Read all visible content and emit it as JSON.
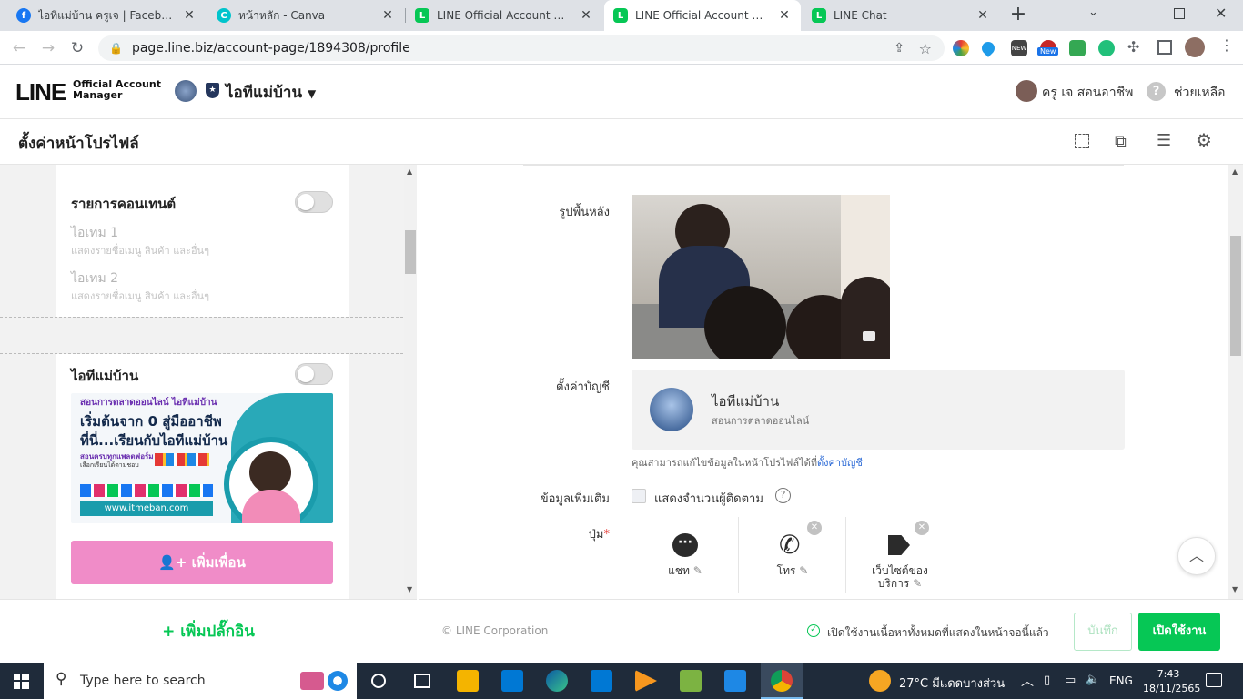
{
  "browser": {
    "tabs": [
      {
        "title": "ไอทีแม่บ้าน ครูเจ | Facebook",
        "icon": "facebook-icon",
        "color": "#1877f2"
      },
      {
        "title": "หน้าหลัก - Canva",
        "icon": "canva-icon",
        "color": "#00c4cc"
      },
      {
        "title": "LINE Official Account Manag",
        "icon": "line-icon",
        "color": "#06c755"
      },
      {
        "title": "LINE Official Account Manag",
        "icon": "line-icon",
        "color": "#06c755"
      },
      {
        "title": "LINE Chat",
        "icon": "line-icon",
        "color": "#06c755"
      }
    ],
    "new_tab": "+",
    "url": "page.line.biz/account-page/1894308/profile",
    "ext_new_badge": "New"
  },
  "header": {
    "logo_main": "LINE",
    "logo_sub1": "Official Account",
    "logo_sub2": "Manager",
    "account_name": "ไอทีแม่บ้าน",
    "user_name": "ครู เจ สอนอาชีพ",
    "help": "ช่วยเหลือ"
  },
  "page": {
    "title": "ตั้งค่าหน้าโปรไฟล์"
  },
  "left": {
    "content_list_title": "รายการคอนเทนต์",
    "items": [
      {
        "title": "ไอเทม 1",
        "desc": "แสดงรายชื่อเมนู สินค้า และอื่นๆ"
      },
      {
        "title": "ไอเทม 2",
        "desc": "แสดงรายชื่อเมนู สินค้า และอื่นๆ"
      }
    ],
    "profile_title": "ไอทีแม่บ้าน",
    "banner": {
      "line1": "สอนการตลาดออนไลน์ ไอทีแม่บ้าน",
      "line2": "เริ่มต้นจาก 0 สู่มืออาชีพ",
      "line3": "ที่นี่...เรียนกับไอทีแม่บ้าน",
      "line4": "สอนครบทุกแพลตฟอร์ม",
      "line5": "เลือกเรียนได้ตามชอบ",
      "url": "www.itmeban.com"
    },
    "add_friend": "เพิ่มเพื่อน",
    "add_plugin": "+ เพิ่มปลั๊กอิน"
  },
  "right": {
    "bg_label": "รูปพื้นหลัง",
    "account_label": "ตั้งค่าบัญชี",
    "account_name": "ไอทีแม่บ้าน",
    "account_desc": "สอนการตลาดออนไลน์",
    "edit_note": "คุณสามารถแก้ไขข้อมูลในหน้าโปรไฟล์ได้ที่",
    "edit_link": "ตั้งค่าบัญชี",
    "extra_label": "ข้อมูลเพิ่มเติม",
    "show_followers": "แสดงจำนวนผู้ติดตาม",
    "buttons_label": "ปุ่ม",
    "required": "*",
    "buttons": [
      {
        "label": "แชท",
        "icon": "chat-icon"
      },
      {
        "label": "โทร",
        "icon": "phone-icon"
      },
      {
        "label": "เว็บไซต์ของ",
        "label2": "บริการ",
        "icon": "tag-icon"
      }
    ]
  },
  "footer": {
    "copyright": "© LINE Corporation",
    "status": "เปิดใช้งานเนื้อหาทั้งหมดที่แสดงในหน้าจอนี้แล้ว",
    "save": "บันทึก",
    "publish": "เปิดใช้งาน"
  },
  "taskbar": {
    "search_placeholder": "Type here to search",
    "weather": "27°C มีแดดบางส่วน",
    "lang": "ENG",
    "time": "7:43",
    "date": "18/11/2565"
  },
  "colors": {
    "line_green": "#06c755",
    "add_friend_pink": "#f08cc8",
    "link_blue": "#2d6bd6"
  }
}
